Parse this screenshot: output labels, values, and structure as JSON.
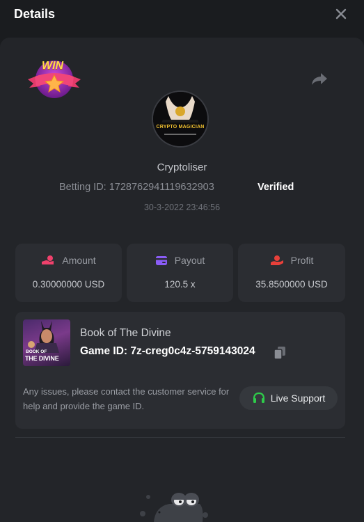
{
  "header": {
    "title": "Details",
    "close_icon": "close-icon"
  },
  "badge": {
    "text": "WIN",
    "icon": "win-star-badge-icon"
  },
  "share_icon": "share-icon",
  "user": {
    "avatar_text": "CRYPTO MAGICIAN",
    "name": "Cryptoliser"
  },
  "bet": {
    "betting_id": "Betting ID: 1728762941119632903",
    "status": "Verified",
    "datetime": "30-3-2022 23:46:56"
  },
  "stats": [
    {
      "label": "Amount",
      "value": "0.30000000 USD",
      "icon": "amount-icon",
      "color": "#f0416c"
    },
    {
      "label": "Payout",
      "value": "120.5 x",
      "icon": "payout-card-icon",
      "color": "#8a5cf6"
    },
    {
      "label": "Profit",
      "value": "35.8500000 USD",
      "icon": "profit-hand-icon",
      "color": "#e8403a"
    }
  ],
  "game": {
    "thumb_line1": "BOOK OF",
    "thumb_line2": "THE DIVINE",
    "name": "Book of The Divine",
    "id_text": "Game ID: 7z-creg0c4z-5759143024",
    "copy_icon": "copy-icon"
  },
  "support": {
    "message": "Any issues, please contact the customer service for help and provide the game ID.",
    "button_label": "Live Support",
    "icon": "headset-icon",
    "icon_color": "#2ecc4a"
  }
}
